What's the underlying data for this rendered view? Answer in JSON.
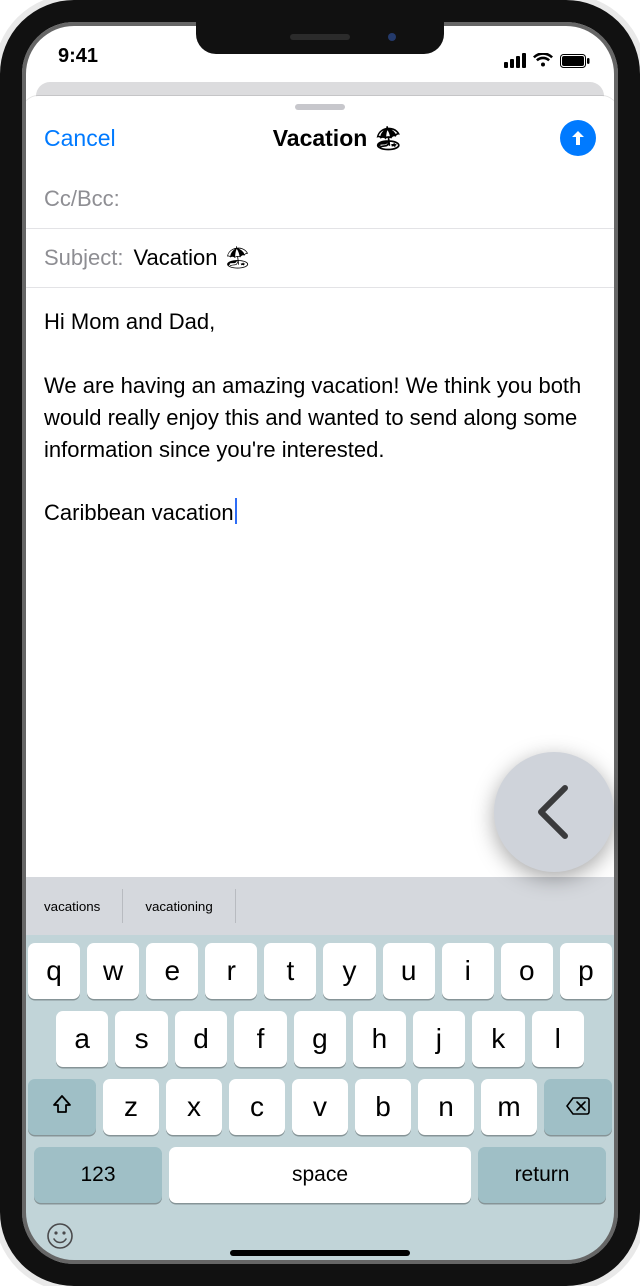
{
  "statusbar": {
    "time": "9:41"
  },
  "compose": {
    "cancel_label": "Cancel",
    "title": "Vacation 🏖",
    "ccbcc_label": "Cc/Bcc:",
    "subject_label": "Subject:",
    "subject_value": "Vacation 🏖",
    "body": "Hi Mom and Dad,\n\nWe are having an amazing vacation! We think you both would really enjoy this and wanted to send along some information since you're interested.\n\nCaribbean vacation"
  },
  "predictive": {
    "s1": "vacations",
    "s2": "vacationing"
  },
  "keyboard": {
    "row1": [
      "q",
      "w",
      "e",
      "r",
      "t",
      "y",
      "u",
      "i",
      "o",
      "p"
    ],
    "row2": [
      "a",
      "s",
      "d",
      "f",
      "g",
      "h",
      "j",
      "k",
      "l"
    ],
    "row3": [
      "z",
      "x",
      "c",
      "v",
      "b",
      "n",
      "m"
    ],
    "num_label": "123",
    "space_label": "space",
    "return_label": "return"
  }
}
